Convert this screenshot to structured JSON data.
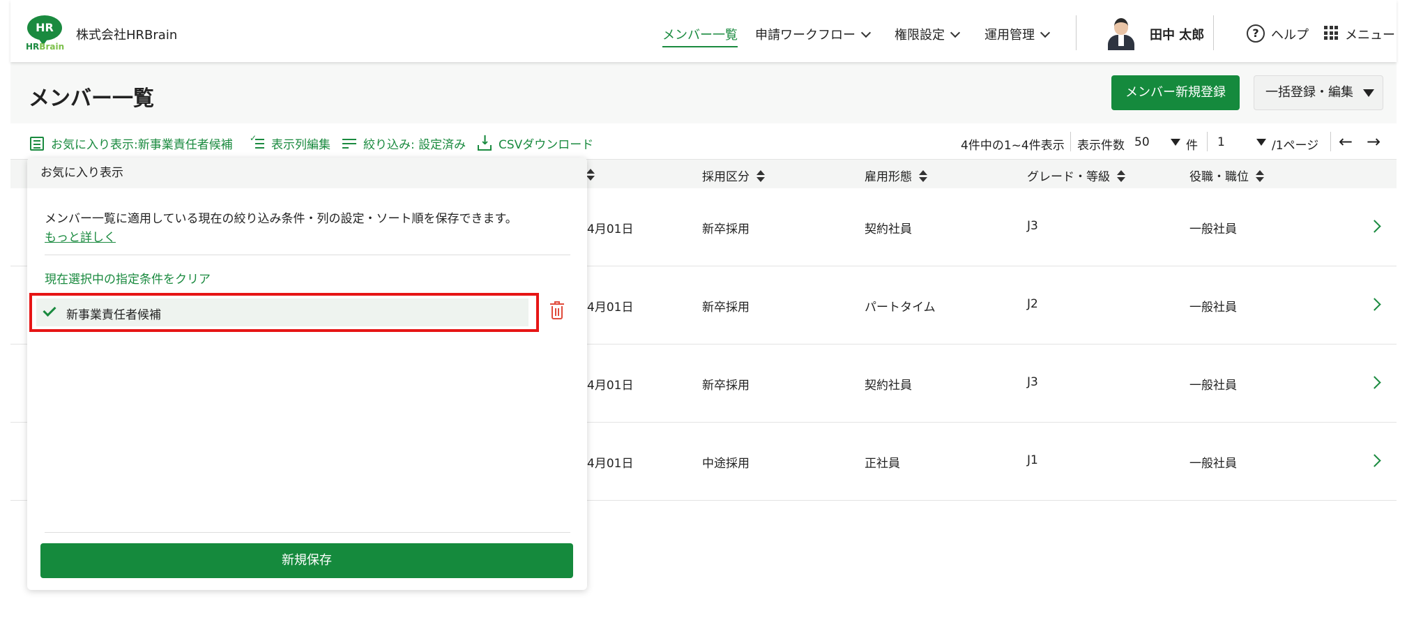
{
  "header": {
    "logo": {
      "bubble_text": "HR",
      "word_primary": "HR",
      "word_secondary": "Brain"
    },
    "company": "株式会社HRBrain",
    "nav": {
      "members": "メンバー一覧",
      "workflow": "申請ワークフロー",
      "permissions": "権限設定",
      "operations": "運用管理"
    },
    "user_name": "田中 太郎",
    "help_icon_text": "?",
    "help": "ヘルプ",
    "menu": "メニュー"
  },
  "titlebar": {
    "title": "メンバー一覧",
    "new_member": "メンバー新規登録",
    "bulk_edit": "一括登録・編集"
  },
  "toolbar": {
    "favorites": "お気に入り表示:新事業責任者候補",
    "columns": "表示列編集",
    "filter": "絞り込み: 設定済み",
    "csv": "CSVダウンロード",
    "count": "4件中の1~4件表示",
    "per_page_label": "表示件数",
    "per_page_value": "50",
    "per_page_unit": "件",
    "page_value": "1",
    "page_total": "/1ページ",
    "prev": "←",
    "next": "→"
  },
  "table": {
    "headers": {
      "hire_type": "採用区分",
      "employment": "雇用形態",
      "grade": "グレード・等級",
      "position": "役職・職位"
    },
    "rows": [
      {
        "date": "4月01日",
        "hire_type": "新卒採用",
        "employment": "契約社員",
        "grade": "J3",
        "position": "一般社員"
      },
      {
        "date": "4月01日",
        "hire_type": "新卒採用",
        "employment": "パートタイム",
        "grade": "J2",
        "position": "一般社員"
      },
      {
        "date": "4月01日",
        "hire_type": "新卒採用",
        "employment": "契約社員",
        "grade": "J3",
        "position": "一般社員"
      },
      {
        "date": "4月01日",
        "hire_type": "中途採用",
        "employment": "正社員",
        "grade": "J1",
        "position": "一般社員"
      }
    ]
  },
  "popup": {
    "title": "お気に入り表示",
    "description": "メンバー一覧に適用している現在の絞り込み条件・列の設定・ソート順を保存できます。",
    "more_link": "もっと詳しく",
    "clear": "現在選択中の指定条件をクリア",
    "item": "新事業責任者候補",
    "save": "新規保存"
  },
  "colors": {
    "primary": "#158a3d",
    "highlight": "#e61515",
    "danger": "#e04b3b"
  }
}
